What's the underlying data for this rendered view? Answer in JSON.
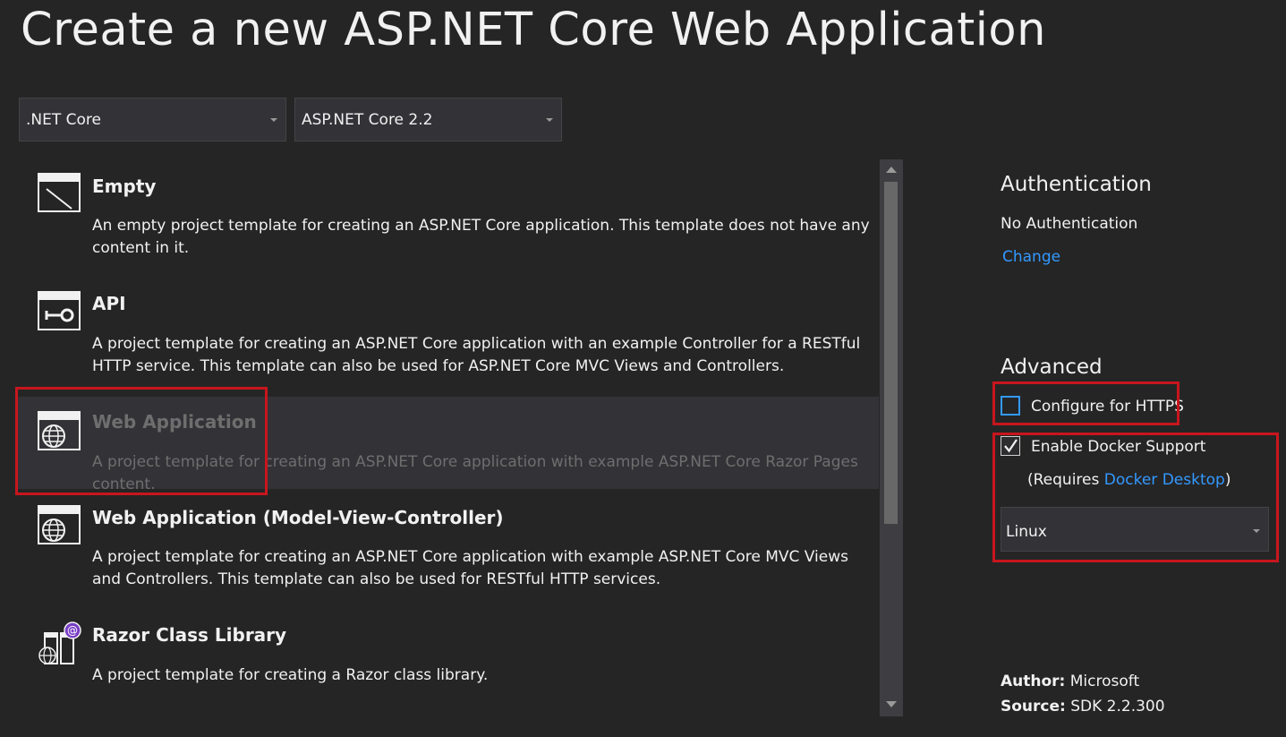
{
  "page_title": "Create a new ASP.NET Core Web Application",
  "framework_select": {
    "value": ".NET Core"
  },
  "version_select": {
    "value": "ASP.NET Core 2.2"
  },
  "templates": [
    {
      "name": "Empty",
      "description": "An empty project template for creating an ASP.NET Core application. This template does not have any content in it.",
      "icon": "empty-project-icon"
    },
    {
      "name": "API",
      "description": "A project template for creating an ASP.NET Core application with an example Controller for a RESTful HTTP service. This template can also be used for ASP.NET Core MVC Views and Controllers.",
      "icon": "api-project-icon"
    },
    {
      "name": "Web Application",
      "description": "A project template for creating an ASP.NET Core application with example ASP.NET Core Razor Pages content.",
      "icon": "web-application-icon",
      "selected": true
    },
    {
      "name": "Web Application (Model-View-Controller)",
      "description": "A project template for creating an ASP.NET Core application with example ASP.NET Core MVC Views and Controllers. This template can also be used for RESTful HTTP services.",
      "icon": "web-mvc-icon"
    },
    {
      "name": "Razor Class Library",
      "description": "A project template for creating a Razor class library.",
      "icon": "razor-class-library-icon"
    }
  ],
  "authentication": {
    "heading": "Authentication",
    "value": "No Authentication",
    "change_label": "Change"
  },
  "advanced": {
    "heading": "Advanced",
    "https_label": "Configure for HTTPS",
    "https_checked": false,
    "docker_label": "Enable Docker Support",
    "docker_checked": true,
    "requires_prefix": "(Requires ",
    "requires_link": "Docker Desktop",
    "requires_suffix": ")",
    "os_value": "Linux"
  },
  "meta": {
    "author_label": "Author:",
    "author_value": "Microsoft",
    "source_label": "Source:",
    "source_value": "SDK 2.2.300"
  },
  "colors": {
    "background": "#252526",
    "accent_link": "#3399ff",
    "highlight_box": "#c8161d",
    "selected_row": "#333337"
  }
}
